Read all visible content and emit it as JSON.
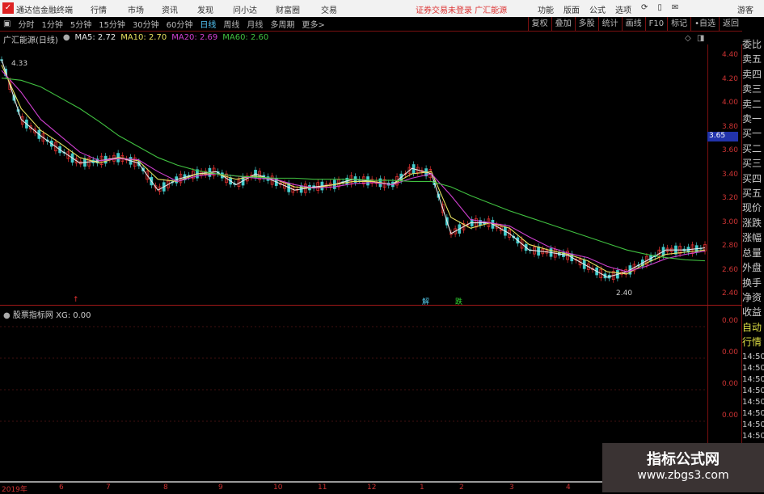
{
  "menubar": {
    "app_title": "通达信金融终端",
    "items": [
      "行情",
      "市场",
      "资讯",
      "发现",
      "问小达",
      "财富圈",
      "交易"
    ],
    "status": "证券交易未登录  广汇能源",
    "right_items": [
      "功能",
      "版面",
      "公式",
      "选项"
    ],
    "user": "游客"
  },
  "toolbar": {
    "periods": [
      "分时",
      "1分钟",
      "5分钟",
      "15分钟",
      "30分钟",
      "60分钟",
      "日线",
      "周线",
      "月线",
      "多周期",
      "更多>"
    ],
    "active": "日线",
    "right_buttons": [
      "复权",
      "叠加",
      "多股",
      "统计",
      "画线",
      "F10",
      "标记",
      "•自选",
      "返回"
    ]
  },
  "info": {
    "stock": "广汇能源(日线)",
    "ma5": "MA5: 2.72",
    "ma10": "MA10: 2.70",
    "ma20": "MA20: 2.69",
    "ma60": "MA60: 2.60"
  },
  "price_axis": [
    "4.40",
    "4.20",
    "4.00",
    "3.80",
    "3.60",
    "3.40",
    "3.20",
    "3.00",
    "2.80",
    "2.60",
    "2.40"
  ],
  "current_price": "3.65",
  "annotations": {
    "high": "4.33",
    "low": "2.40"
  },
  "signals": [
    {
      "label": "↑",
      "color": "#e33"
    },
    {
      "label": "解",
      "color": "#5ce"
    },
    {
      "label": "跌",
      "color": "#3d3"
    }
  ],
  "right_panel": [
    "委比",
    "卖五",
    "卖四",
    "卖三",
    "卖二",
    "卖一",
    "买一",
    "买二",
    "买三",
    "买四",
    "买五",
    "现价",
    "涨跌",
    "涨幅",
    "总量",
    "外盘",
    "换手",
    "净资",
    "收益",
    "自动",
    "行情",
    "14:50",
    "14:50",
    "14:50",
    "14:50",
    "14:50",
    "14:50",
    "14:50",
    "14:50"
  ],
  "indicator": {
    "name": "股票指标网",
    "value": "XG: 0.00",
    "axis": [
      "0.00",
      "0.00",
      "0.00",
      "0.00"
    ]
  },
  "time_axis": [
    "2019年",
    "6",
    "7",
    "8",
    "9",
    "10",
    "11",
    "12",
    "1",
    "2",
    "3",
    "4"
  ],
  "watermark": {
    "title": "指标公式网",
    "url": "www.zbgs3.com"
  },
  "colors": {
    "ma5": "#e8e8e8",
    "ma10": "#e8e060",
    "ma20": "#d040d0",
    "ma60": "#40c040",
    "up": "#e33",
    "down": "#4cc"
  },
  "chart_data": {
    "type": "line",
    "ylim": [
      2.3,
      4.5
    ],
    "series": [
      {
        "name": "MA5",
        "values": [
          4.45,
          3.9,
          3.75,
          3.62,
          3.5,
          3.52,
          3.55,
          3.5,
          3.25,
          3.35,
          3.4,
          3.42,
          3.3,
          3.4,
          3.33,
          3.25,
          3.28,
          3.3,
          3.35,
          3.33,
          3.3,
          3.45,
          3.4,
          2.85,
          2.95,
          2.95,
          2.85,
          2.7,
          2.68,
          2.65,
          2.55,
          2.45,
          2.5,
          2.6,
          2.7,
          2.7,
          2.72
        ]
      },
      {
        "name": "MA10",
        "values": [
          4.4,
          4.0,
          3.8,
          3.68,
          3.55,
          3.5,
          3.55,
          3.52,
          3.35,
          3.33,
          3.4,
          3.4,
          3.35,
          3.38,
          3.35,
          3.28,
          3.27,
          3.3,
          3.33,
          3.33,
          3.3,
          3.4,
          3.42,
          3.0,
          2.9,
          2.95,
          2.9,
          2.75,
          2.7,
          2.66,
          2.6,
          2.5,
          2.48,
          2.58,
          2.66,
          2.68,
          2.7
        ]
      },
      {
        "name": "MA20",
        "values": [
          4.35,
          4.15,
          3.9,
          3.75,
          3.6,
          3.52,
          3.54,
          3.53,
          3.42,
          3.33,
          3.38,
          3.4,
          3.38,
          3.36,
          3.35,
          3.3,
          3.27,
          3.28,
          3.31,
          3.32,
          3.3,
          3.36,
          3.4,
          3.2,
          2.98,
          2.95,
          2.92,
          2.82,
          2.73,
          2.67,
          2.63,
          2.55,
          2.5,
          2.55,
          2.62,
          2.66,
          2.69
        ]
      },
      {
        "name": "MA60",
        "values": [
          4.28,
          4.26,
          4.2,
          4.1,
          4.0,
          3.88,
          3.75,
          3.65,
          3.55,
          3.48,
          3.43,
          3.4,
          3.38,
          3.37,
          3.36,
          3.36,
          3.35,
          3.35,
          3.35,
          3.34,
          3.34,
          3.33,
          3.33,
          3.28,
          3.2,
          3.13,
          3.06,
          3.0,
          2.94,
          2.88,
          2.82,
          2.76,
          2.7,
          2.66,
          2.63,
          2.61,
          2.6
        ]
      }
    ]
  }
}
